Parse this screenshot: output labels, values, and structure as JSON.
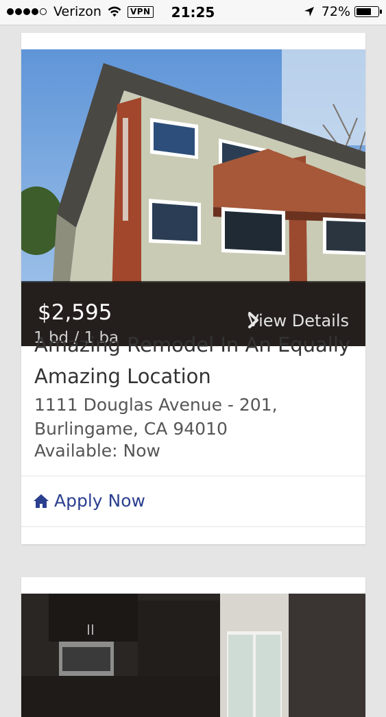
{
  "status_bar": {
    "carrier": "Verizon",
    "vpn": "VPN",
    "time": "21:25",
    "battery_percent": "72%",
    "battery_level": 0.72
  },
  "listings": [
    {
      "price": "$2,595",
      "beds_baths": "1 bd / 1 ba",
      "view_details": "View Details",
      "title": "Amazing Remodel In An Equally Amazing Location",
      "address": "1111 Douglas Avenue - 201, Burlingame, CA 94010",
      "availability": "Available: Now",
      "apply_label": "Apply Now"
    }
  ],
  "icons": {
    "wifi": "wifi-icon",
    "location": "location-arrow-icon",
    "battery": "battery-icon",
    "chevron": "chevron-right-icon",
    "home": "home-icon"
  },
  "colors": {
    "accent": "#2b3f8f",
    "page_background": "#e5e5e5",
    "price_overlay": "#0f0f0f"
  }
}
